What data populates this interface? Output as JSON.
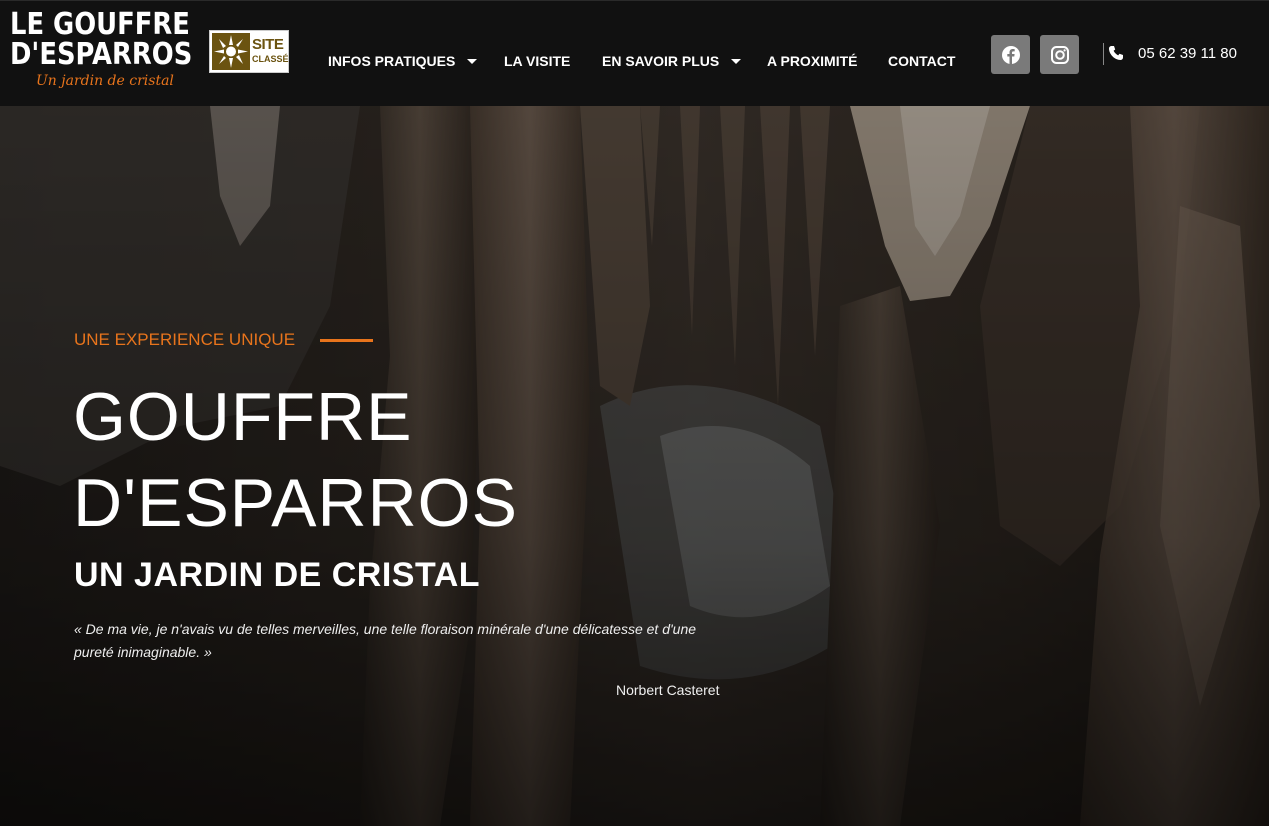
{
  "brand": {
    "logo_line1": "LE GOUFFRE",
    "logo_line2": "D'ESPARROS",
    "logo_tagline": "Un jardin de cristal",
    "badge_line1": "SITE",
    "badge_line2": "CLASSÉ"
  },
  "nav": {
    "items": [
      {
        "label": "INFOS PRATIQUES",
        "has_dropdown": true
      },
      {
        "label": "LA VISITE",
        "has_dropdown": false
      },
      {
        "label": "EN SAVOIR PLUS",
        "has_dropdown": true
      },
      {
        "label": "A PROXIMITÉ",
        "has_dropdown": false
      },
      {
        "label": "CONTACT",
        "has_dropdown": false
      }
    ]
  },
  "social": {
    "facebook_icon": "facebook-icon",
    "instagram_icon": "instagram-icon"
  },
  "contact": {
    "phone": "05 62 39 11 80",
    "phone_icon": "phone-icon"
  },
  "hero": {
    "kicker": "UNE EXPERIENCE UNIQUE",
    "title_line1": "GOUFFRE",
    "title_line2": "D'ESPARROS",
    "subtitle": "UN JARDIN DE CRISTAL",
    "quote": "« De ma vie, je n'avais vu de telles merveilles, une telle floraison minérale d'une délicatesse et d'une pureté inimaginable. »",
    "author": "Norbert Casteret"
  },
  "colors": {
    "accent": "#e8741c",
    "header_bg": "#111111",
    "social_bg": "#7a7a7a",
    "badge_gold": "#6b5310"
  }
}
